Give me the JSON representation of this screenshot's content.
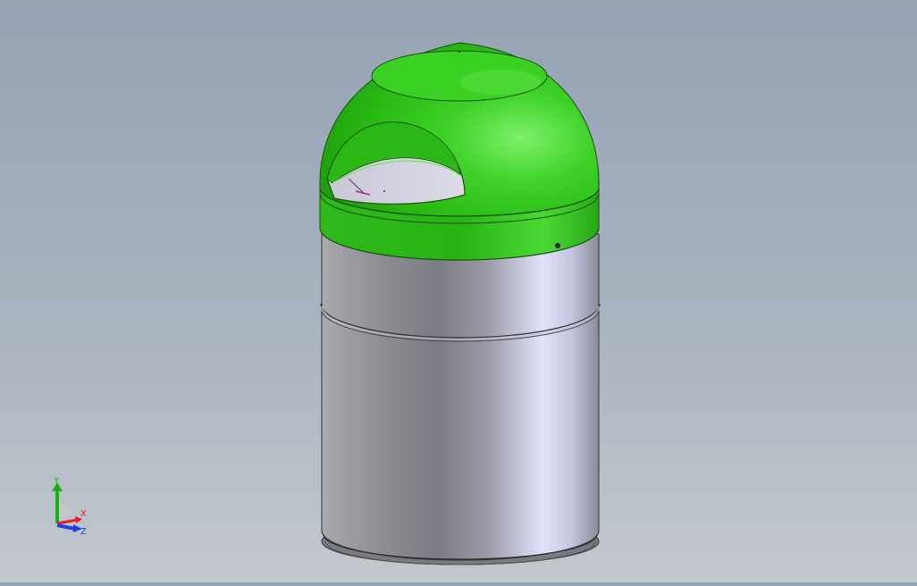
{
  "viewport": {
    "background_top": "#95a3b4",
    "background_bottom": "#c3c8cd"
  },
  "model": {
    "lid_color": "#2fbf1a",
    "body_color": "#9a9aa8",
    "body_highlight": "#e4e4fa"
  },
  "triad": {
    "x_label": "X",
    "y_label": "Y",
    "z_label": "Z",
    "x_color": "#e02020",
    "y_color": "#18b018",
    "z_color": "#2040e0"
  }
}
